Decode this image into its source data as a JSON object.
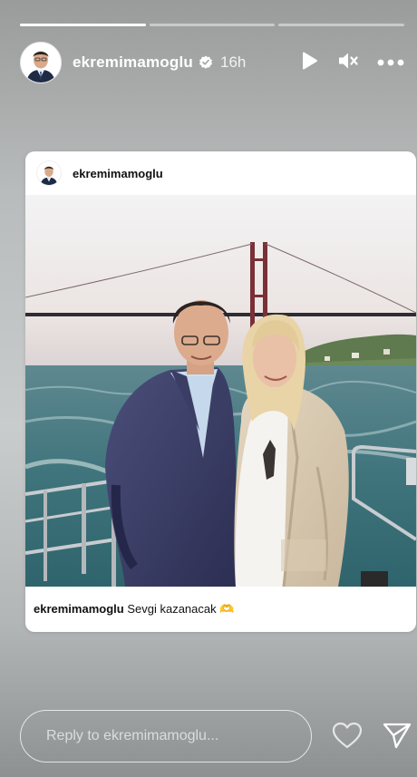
{
  "story": {
    "progress_segments": 3,
    "active_segment": 0
  },
  "header": {
    "username": "ekremimamoglu",
    "time": "16h",
    "verified": true
  },
  "post": {
    "username": "ekremimamoglu",
    "caption_user": "ekremimamoglu",
    "caption_text": "Sevgi kazanacak",
    "caption_emoji": "🫶"
  },
  "reply": {
    "placeholder": "Reply to ekremimamoglu..."
  },
  "icons": {
    "play": "play-icon",
    "mute": "mute-icon",
    "more": "more-icon",
    "heart": "heart-icon",
    "send": "send-icon"
  },
  "colors": {
    "verified": "#ffffff",
    "card": "#ffffff"
  }
}
